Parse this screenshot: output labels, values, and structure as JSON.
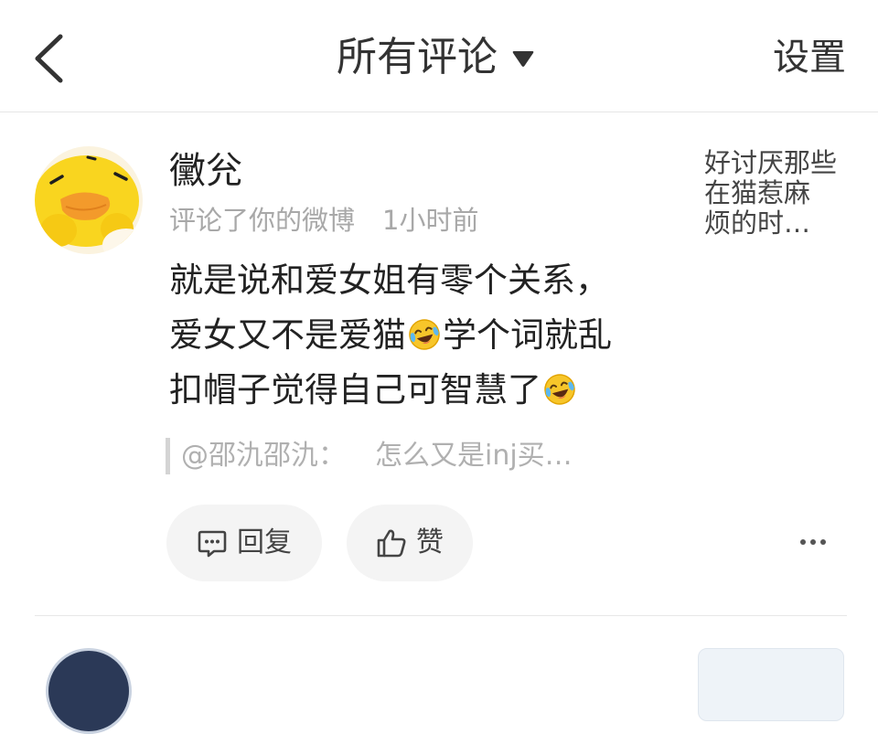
{
  "nav": {
    "back_icon": "chevron-left-icon",
    "title": "所有评论",
    "dropdown_icon": "caret-down-icon",
    "settings_label": "设置"
  },
  "comment": {
    "avatar": "duck-avatar",
    "username": "黴兊",
    "action": "评论了你的微博",
    "time": "1小时前",
    "body": {
      "line1": "就是说和爱女姐有零个关系，",
      "line2_before": "爱女又不是爱猫",
      "line2_after": "学个词就乱",
      "line3": "扣帽子觉得自己可智慧了",
      "emoji": "laugh-cry-emoji"
    },
    "quote": {
      "author": "@邵氿邵氿：",
      "text": "怎么又是inj买…"
    },
    "actions": {
      "reply_icon": "comment-icon",
      "reply_label": "回复",
      "like_icon": "thumbs-up-icon",
      "like_label": "赞",
      "more_icon": "more-icon"
    },
    "source_preview": {
      "lines": [
        "好讨厌那些",
        "在猫惹麻",
        "烦的时…"
      ]
    }
  },
  "next_comment": {
    "avatar": "avatar-image",
    "source_preview": "source-thumbnail"
  },
  "colors": {
    "text_primary": "#222222",
    "text_secondary": "#a8a8a8",
    "quote_text": "#b0b0b0",
    "button_bg": "#f4f4f4",
    "divider": "#e8e8e8"
  }
}
